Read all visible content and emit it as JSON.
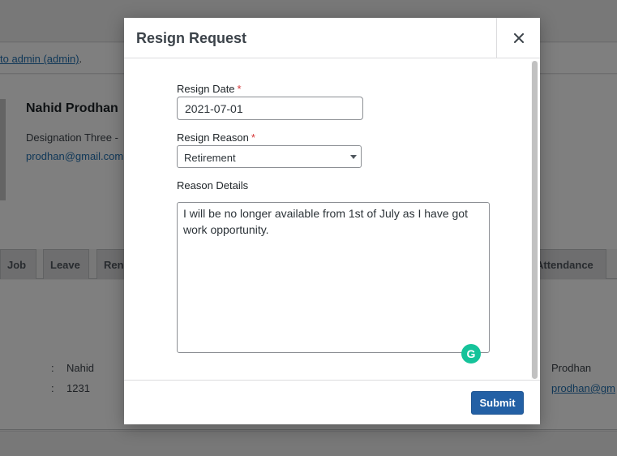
{
  "background": {
    "notice_link": "to admin (admin)",
    "notice_suffix": ".",
    "employee_name": "Nahid Prodhan",
    "designation": "Designation Three -",
    "email": "prodhan@gmail.com",
    "tabs": [
      "Job",
      "Leave",
      "Ren",
      "Attendance"
    ],
    "first_name_colon": ":",
    "first_name": "Nahid",
    "employee_id_colon": ":",
    "employee_id": "1231",
    "last_name": "Prodhan",
    "email_partial": "prodhan@gm"
  },
  "modal": {
    "title": "Resign Request",
    "close_icon": "close-icon",
    "resign_date_label": "Resign Date",
    "resign_date_value": "2021-07-01",
    "required_marker": "*",
    "resign_reason_label": "Resign Reason",
    "resign_reason_value": "Retirement",
    "reason_details_label": "Reason Details",
    "reason_details_value": "I will be no longer available from 1st of July as I have got work opportunity.",
    "grammarly_icon": "grammarly-icon",
    "grammarly_glyph": "G",
    "submit_label": "Submit"
  },
  "colors": {
    "primary_button": "#2360a5",
    "required": "#d63638",
    "link": "#2271b1",
    "grammarly": "#15c39a"
  }
}
